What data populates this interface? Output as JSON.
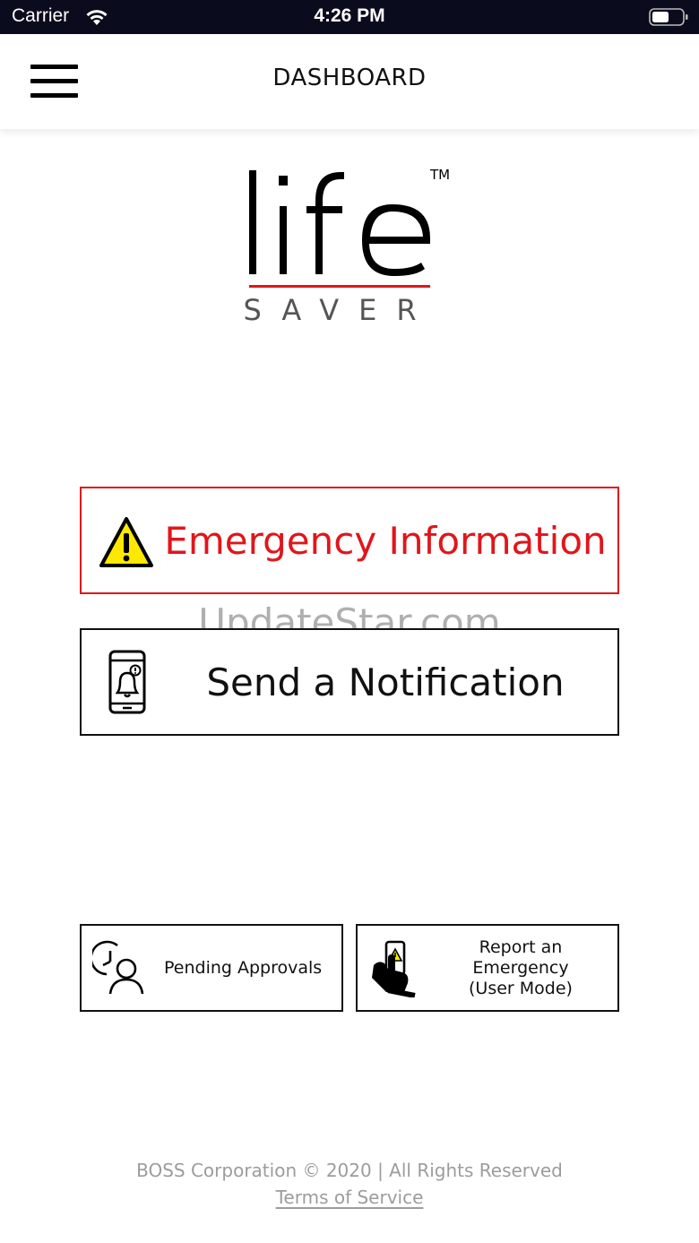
{
  "status_bar": {
    "carrier": "Carrier",
    "time": "4:26 PM",
    "wifi_icon": "wifi-icon",
    "battery_icon": "battery-icon"
  },
  "header": {
    "title": "DASHBOARD",
    "menu_icon": "hamburger-menu-icon"
  },
  "logo": {
    "word": "life",
    "subword": "SAVER",
    "trademark": "TM",
    "accent_color": "#e0161b"
  },
  "buttons": {
    "emergency_info": {
      "label": "Emergency Information",
      "icon": "warning-triangle-icon",
      "color": "#e0161b"
    },
    "send_notification": {
      "label": "Send a Notification",
      "icon": "phone-bell-icon"
    },
    "pending_approvals": {
      "label": "Pending Approvals",
      "icon": "clock-user-icon"
    },
    "report_emergency": {
      "label_line1": "Report an",
      "label_line2": "Emergency",
      "label_line3": "(User Mode)",
      "icon": "hand-phone-warning-icon"
    }
  },
  "watermark": "UpdateStar.com",
  "footer": {
    "copyright": "BOSS Corporation © 2020 | All Rights Reserved",
    "terms_link": "Terms of Service"
  }
}
